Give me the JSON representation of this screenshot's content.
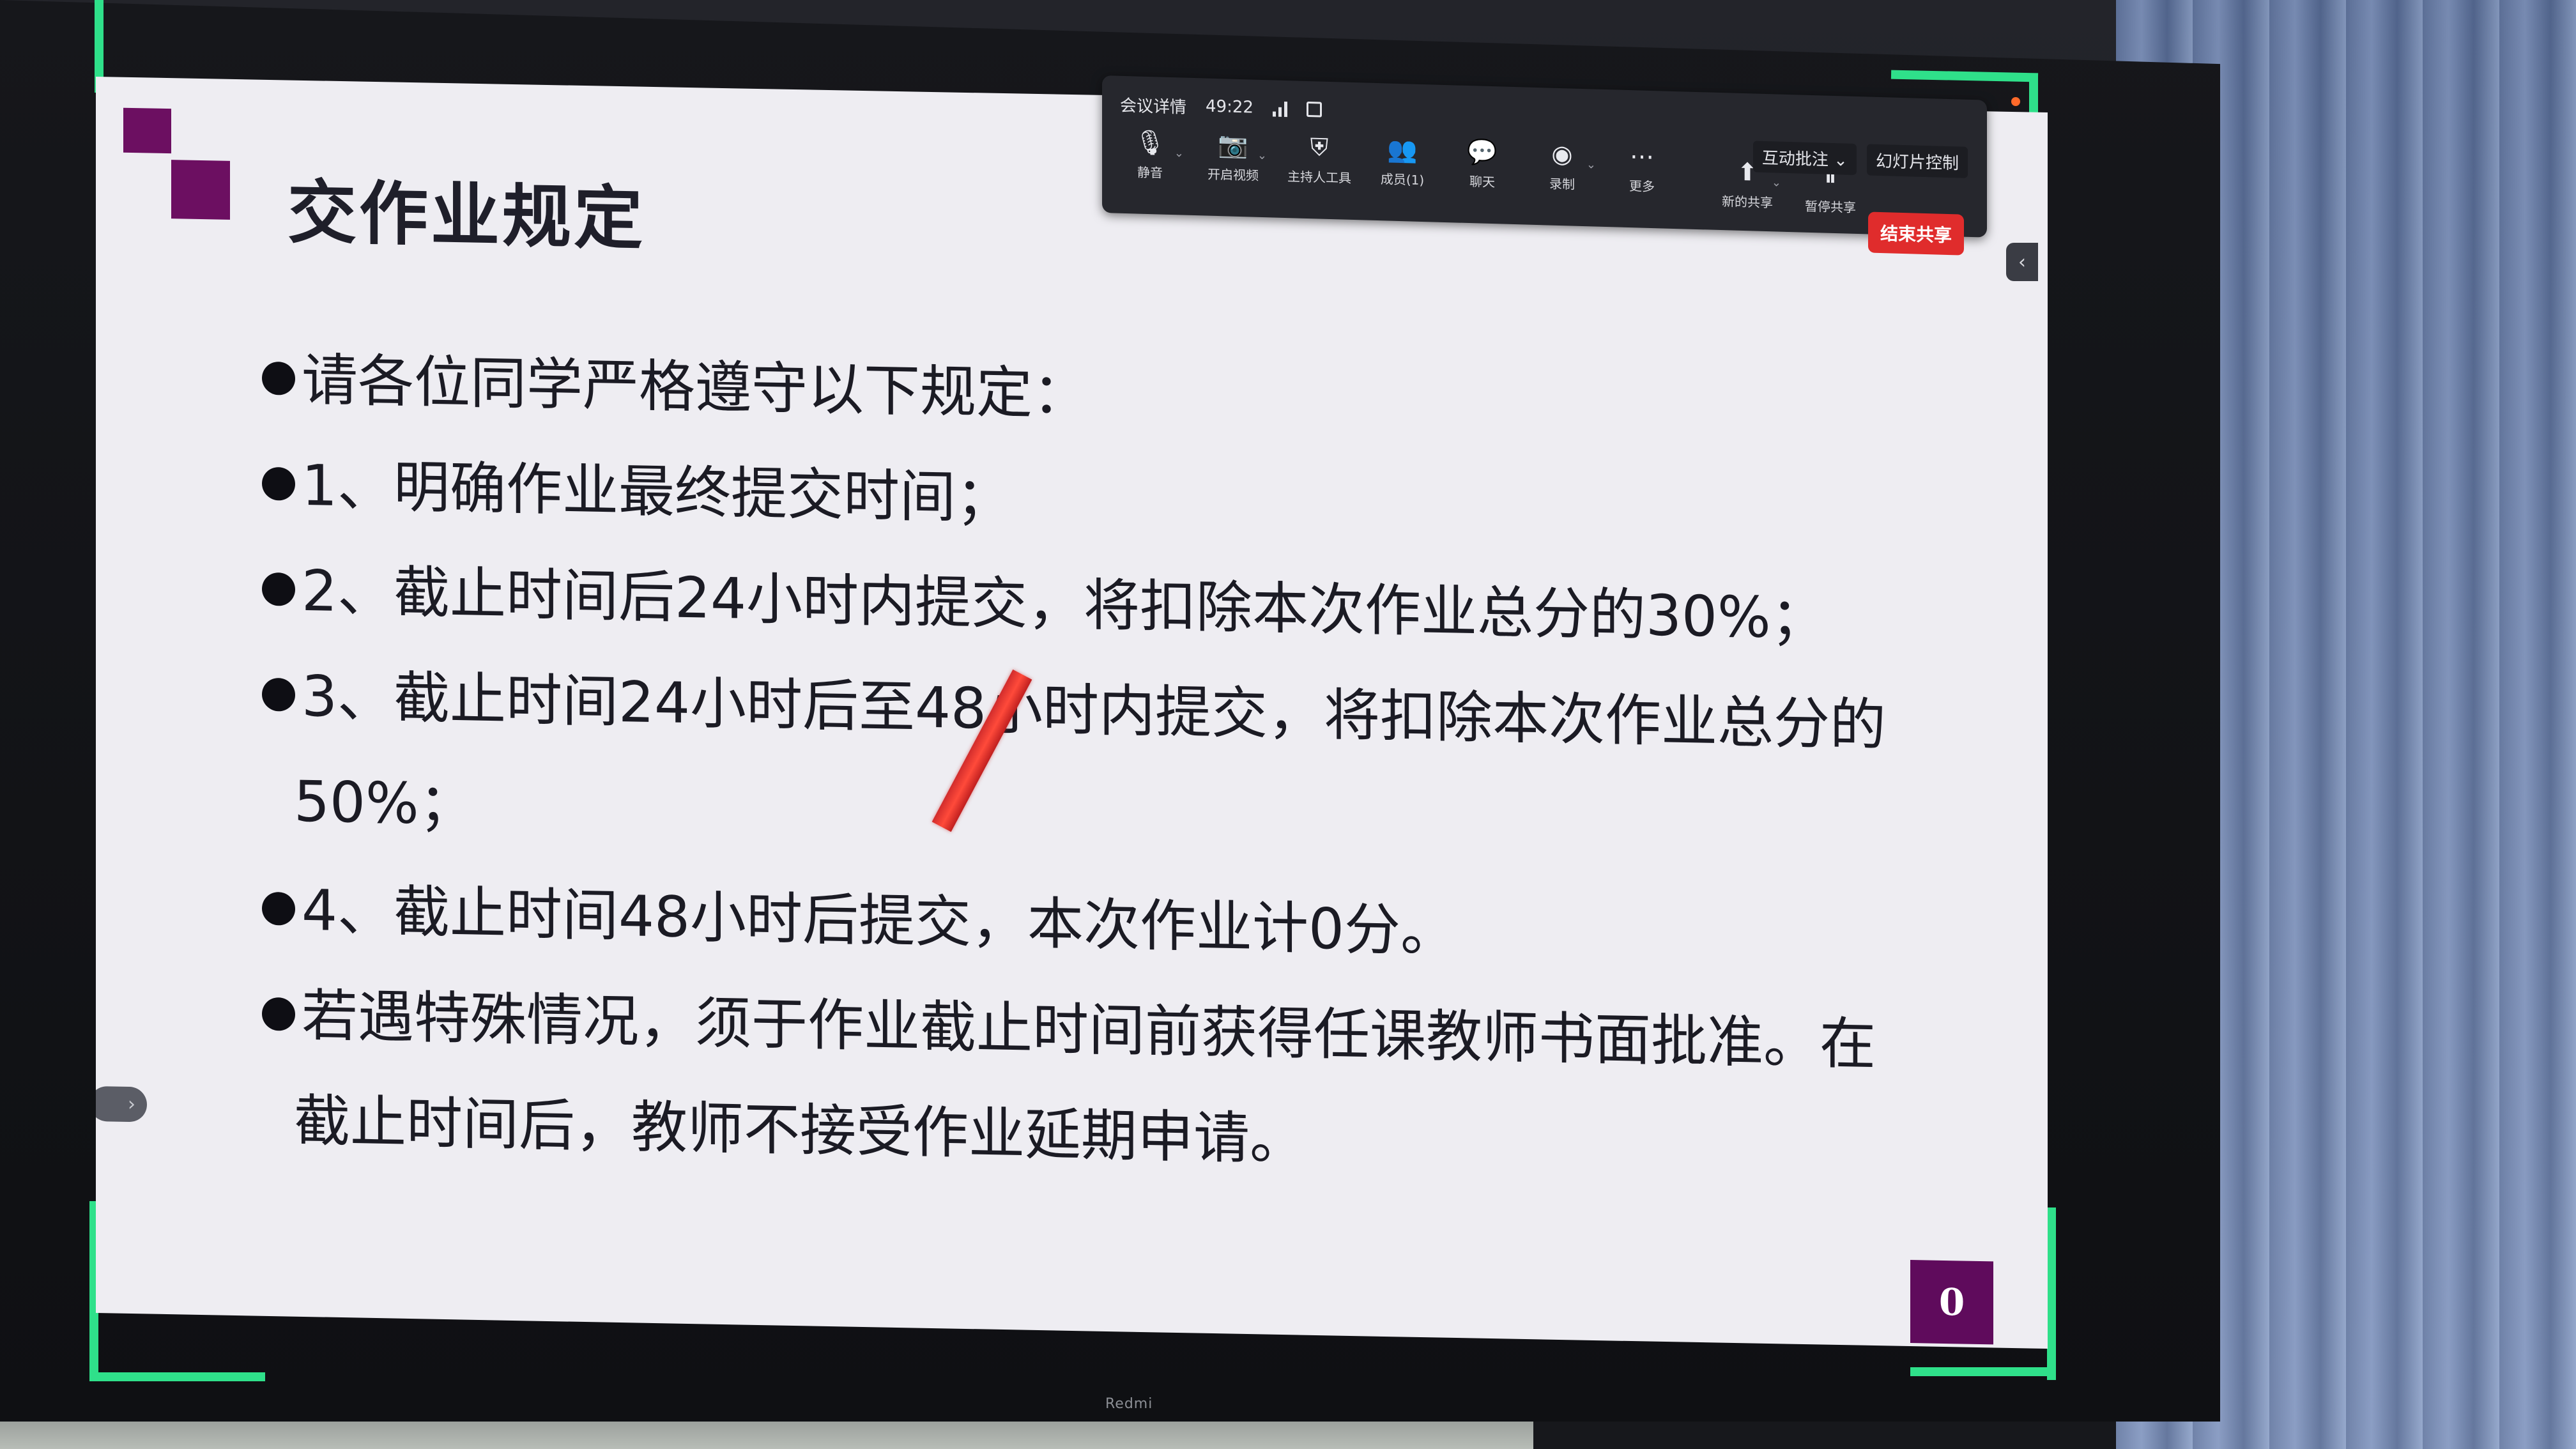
{
  "slide": {
    "title": "交作业规定",
    "bullets": [
      {
        "text": "请各位同学严格遵守以下规定："
      },
      {
        "text": "1、明确作业最终提交时间；"
      },
      {
        "text": "2、截止时间后24小时内提交，将扣除本次作业总分的30%；"
      },
      {
        "text": "3、截止时间24小时后至48小时内提交，将扣除本次作业总分的",
        "continuation": "50%；"
      },
      {
        "text": "4、截止时间48小时后提交，本次作业计0分。"
      },
      {
        "text": "若遇特殊情况，须于作业截止时间前获得任课教师书面批准。在",
        "continuation": "截止时间后，教师不接受作业延期申请。"
      }
    ],
    "page_number": "0",
    "accent_color": "#6c0f61"
  },
  "meeting_toolbar": {
    "info_label": "会议详情",
    "timer": "49:22",
    "buttons": [
      {
        "icon": "microphone-icon",
        "label": "静音"
      },
      {
        "icon": "video-camera-icon",
        "label": "开启视频"
      },
      {
        "icon": "shield-icon",
        "label": "主持人工具"
      },
      {
        "icon": "members-icon",
        "label": "成员(1)"
      },
      {
        "icon": "chat-icon",
        "label": "聊天"
      },
      {
        "icon": "record-icon",
        "label": "录制"
      },
      {
        "icon": "more-icon",
        "label": "更多"
      },
      {
        "icon": "new-share-icon",
        "label": "新的共享"
      },
      {
        "icon": "pause-share-icon",
        "label": "暂停共享"
      }
    ],
    "annotate_label": "互动批注",
    "slide_control_label": "幻灯片控制",
    "end_share_label": "结束共享",
    "end_share_color": "#e02c2c"
  },
  "share_border_color": "#2fe08a",
  "tv_brand": "Redmi"
}
